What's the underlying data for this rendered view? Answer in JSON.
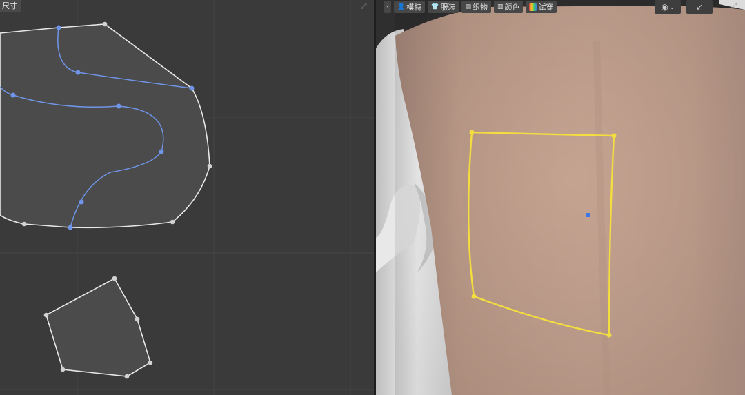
{
  "pattern_view": {
    "size_tab_label": "尺寸",
    "expand_icon": "expand-icon"
  },
  "avatar_view": {
    "back_icon": "chevron-left-icon",
    "toolbar": [
      {
        "label": "模特",
        "icon": "avatar-icon"
      },
      {
        "label": "服装",
        "icon": "tshirt-icon"
      },
      {
        "label": "织物",
        "icon": "fabric-icon"
      },
      {
        "label": "颜色",
        "icon": "color-swatch-icon"
      },
      {
        "label": "试穿",
        "icon": "simulate-icon"
      }
    ],
    "camera_icon": "camera-icon",
    "collapse_icon": "collapse-icon",
    "expand_icon": "expand-icon"
  },
  "colors": {
    "pattern_fill": "#4b4b4b",
    "pattern_outline": "#e8e8e8",
    "internal_line": "#6f94e8",
    "selected_outline": "#f3dd3f",
    "grid": "#454545"
  }
}
